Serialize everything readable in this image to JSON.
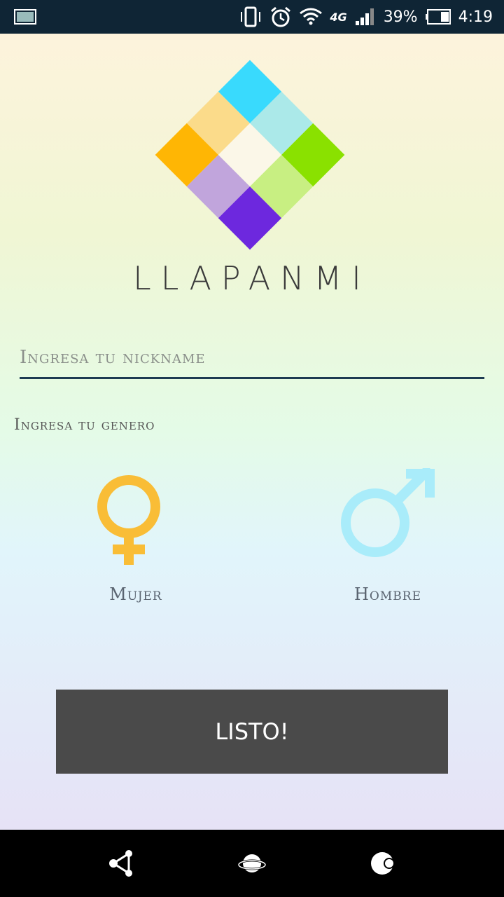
{
  "status_bar": {
    "battery_percent": "39%",
    "time": "4:19",
    "network": "4G",
    "icons": [
      "image-icon",
      "vibrate-icon",
      "alarm-icon",
      "wifi-icon",
      "signal-icon",
      "battery-icon"
    ]
  },
  "app": {
    "brand": "LLAPANMI",
    "nickname_placeholder": "Ingresa tu nickname",
    "gender_prompt": "Ingresa tu genero",
    "genders": [
      {
        "label": "Mujer",
        "icon": "female-icon",
        "color": "#f9bd36"
      },
      {
        "label": "Hombre",
        "icon": "male-icon",
        "color": "#a9ecfa"
      }
    ],
    "done_button": "LISTO!"
  },
  "nav_bar": {
    "icons": [
      "share-icon",
      "planet-icon",
      "moon-icon"
    ]
  },
  "colors": {
    "status_bg": "#0f2535",
    "button_bg": "#4a4a4a",
    "underline": "#1d3b52",
    "logo": [
      "#39dafd",
      "#fbdb8a",
      "#abe9e9",
      "#ffb604",
      "#8ae100",
      "#c1a5dc",
      "#c8ef82",
      "#6d28de"
    ]
  }
}
